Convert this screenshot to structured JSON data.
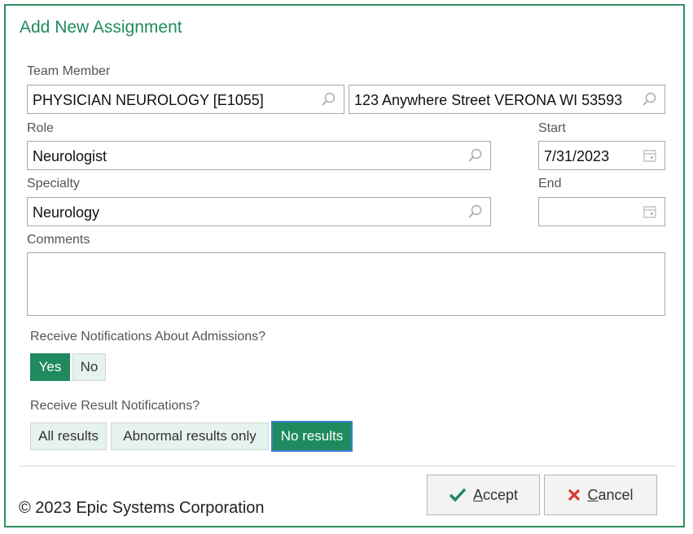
{
  "dialog": {
    "title": "Add New Assignment"
  },
  "team_member": {
    "label": "Team Member",
    "value": "PHYSICIAN NEUROLOGY [E1055]",
    "address": "123 Anywhere Street VERONA WI 53593"
  },
  "role": {
    "label": "Role",
    "value": "Neurologist"
  },
  "start": {
    "label": "Start",
    "value": "7/31/2023"
  },
  "specialty": {
    "label": "Specialty",
    "value": "Neurology"
  },
  "end": {
    "label": "End",
    "value": ""
  },
  "comments": {
    "label": "Comments",
    "value": ""
  },
  "admissions": {
    "question": "Receive Notifications About Admissions?",
    "options": [
      "Yes",
      "No"
    ],
    "selected": "Yes"
  },
  "results": {
    "question": "Receive Result Notifications?",
    "options": [
      "All results",
      "Abnormal results only",
      "No results"
    ],
    "selected": "No results"
  },
  "footer": {
    "copyright": "© 2023 Epic Systems Corporation",
    "accept_first": "A",
    "accept_rest": "ccept",
    "cancel_first": "C",
    "cancel_rest": "ancel"
  },
  "colors": {
    "accent": "#1f8a5e",
    "border": "#2f8f62",
    "toggle_bg": "#e6f2ee",
    "accept_check": "#1f8a5e",
    "cancel_x": "#d83a2e"
  },
  "icons": {
    "lookup": "magnifier-icon",
    "date": "calendar-icon",
    "accept": "check-icon",
    "cancel": "x-icon"
  }
}
